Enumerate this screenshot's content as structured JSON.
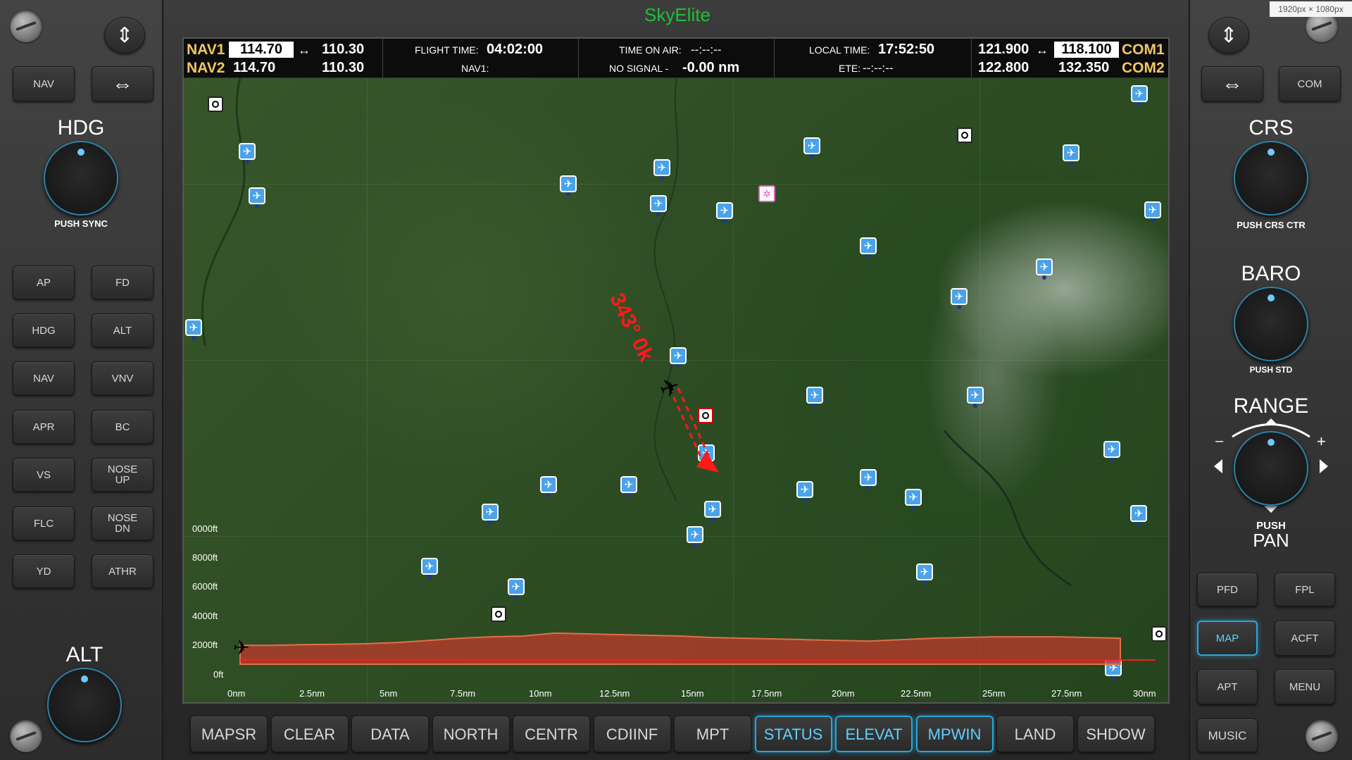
{
  "app": {
    "brand": "SkyElite"
  },
  "nav": {
    "nav1_label": "NAV1",
    "nav1_active": "114.70",
    "nav1_standby": "110.30",
    "nav2_label": "NAV2",
    "nav2_active": "114.70",
    "nav2_standby": "110.30"
  },
  "com": {
    "com1_label": "COM1",
    "com1_standby": "121.900",
    "com1_active": "118.100",
    "com2_label": "COM2",
    "com2_standby": "122.800",
    "com2_active": "132.350"
  },
  "status": {
    "flight_time_label": "FLIGHT TIME:",
    "flight_time": "04:02:00",
    "nav1_label": "NAV1:",
    "time_on_air_label": "TIME ON AIR:",
    "time_on_air": "--:--:--",
    "no_signal_label": "NO SIGNAL -",
    "distance": "-0.00 nm",
    "local_time_label": "LOCAL TIME:",
    "local_time": "17:52:50",
    "ete_label": "ETE:",
    "ete": "--:--:--"
  },
  "left_panel": {
    "nav_btn": "NAV",
    "hdg_title": "HDG",
    "hdg_sub": "PUSH SYNC",
    "buttons": [
      "AP",
      "FD",
      "HDG",
      "ALT",
      "NAV",
      "VNV",
      "APR",
      "BC",
      "VS",
      "NOSE UP",
      "FLC",
      "NOSE DN",
      "YD",
      "ATHR"
    ],
    "alt_title": "ALT"
  },
  "right_panel": {
    "com_btn": "COM",
    "crs_title": "CRS",
    "crs_sub": "PUSH CRS CTR",
    "baro_title": "BARO",
    "baro_sub": "PUSH STD",
    "range_title": "RANGE",
    "range_sub1": "PUSH",
    "range_sub2": "PAN",
    "buttons": [
      "PFD",
      "FPL",
      "MAP",
      "ACFT",
      "APT",
      "MENU",
      "MUSIC"
    ],
    "active": "MAP"
  },
  "softkeys": [
    {
      "label": "MAPSR",
      "active": false
    },
    {
      "label": "CLEAR",
      "active": false
    },
    {
      "label": "DATA",
      "active": false
    },
    {
      "label": "NORTH",
      "active": false
    },
    {
      "label": "CENTR",
      "active": false
    },
    {
      "label": "CDIINF",
      "active": false
    },
    {
      "label": "MPT",
      "active": false
    },
    {
      "label": "STATUS",
      "active": true
    },
    {
      "label": "ELEVAT",
      "active": true
    },
    {
      "label": "MPWIN",
      "active": true
    },
    {
      "label": "LAND",
      "active": false
    },
    {
      "label": "SHDOW",
      "active": false
    }
  ],
  "map": {
    "heading_label": "343° 0k",
    "elevation_y_labels": [
      "0000ft",
      "8000ft",
      "6000ft",
      "4000ft",
      "2000ft",
      "0ft"
    ],
    "elevation_x_labels": [
      "0nm",
      "2.5nm",
      "5nm",
      "7.5nm",
      "10nm",
      "12.5nm",
      "15nm",
      "17.5nm",
      "20nm",
      "22.5nm",
      "25nm",
      "27.5nm",
      "30nm"
    ],
    "terrain_profile_ft": [
      1300,
      1300,
      1350,
      1380,
      1420,
      1500,
      1650,
      1800,
      1900,
      1950,
      2150,
      2100,
      2050,
      2000,
      1950,
      1850,
      1800,
      1750,
      1700,
      1650,
      1600,
      1700,
      1800,
      1850,
      1900,
      1900,
      1900,
      1850,
      1800
    ],
    "colors": {
      "terrain": "#c0392b",
      "track": "#ff1a1a",
      "airport": "#4aa3ea",
      "brand": "#1fbf3a",
      "active": "#2aa7d8"
    }
  },
  "size_label": "1920px × 1080px"
}
